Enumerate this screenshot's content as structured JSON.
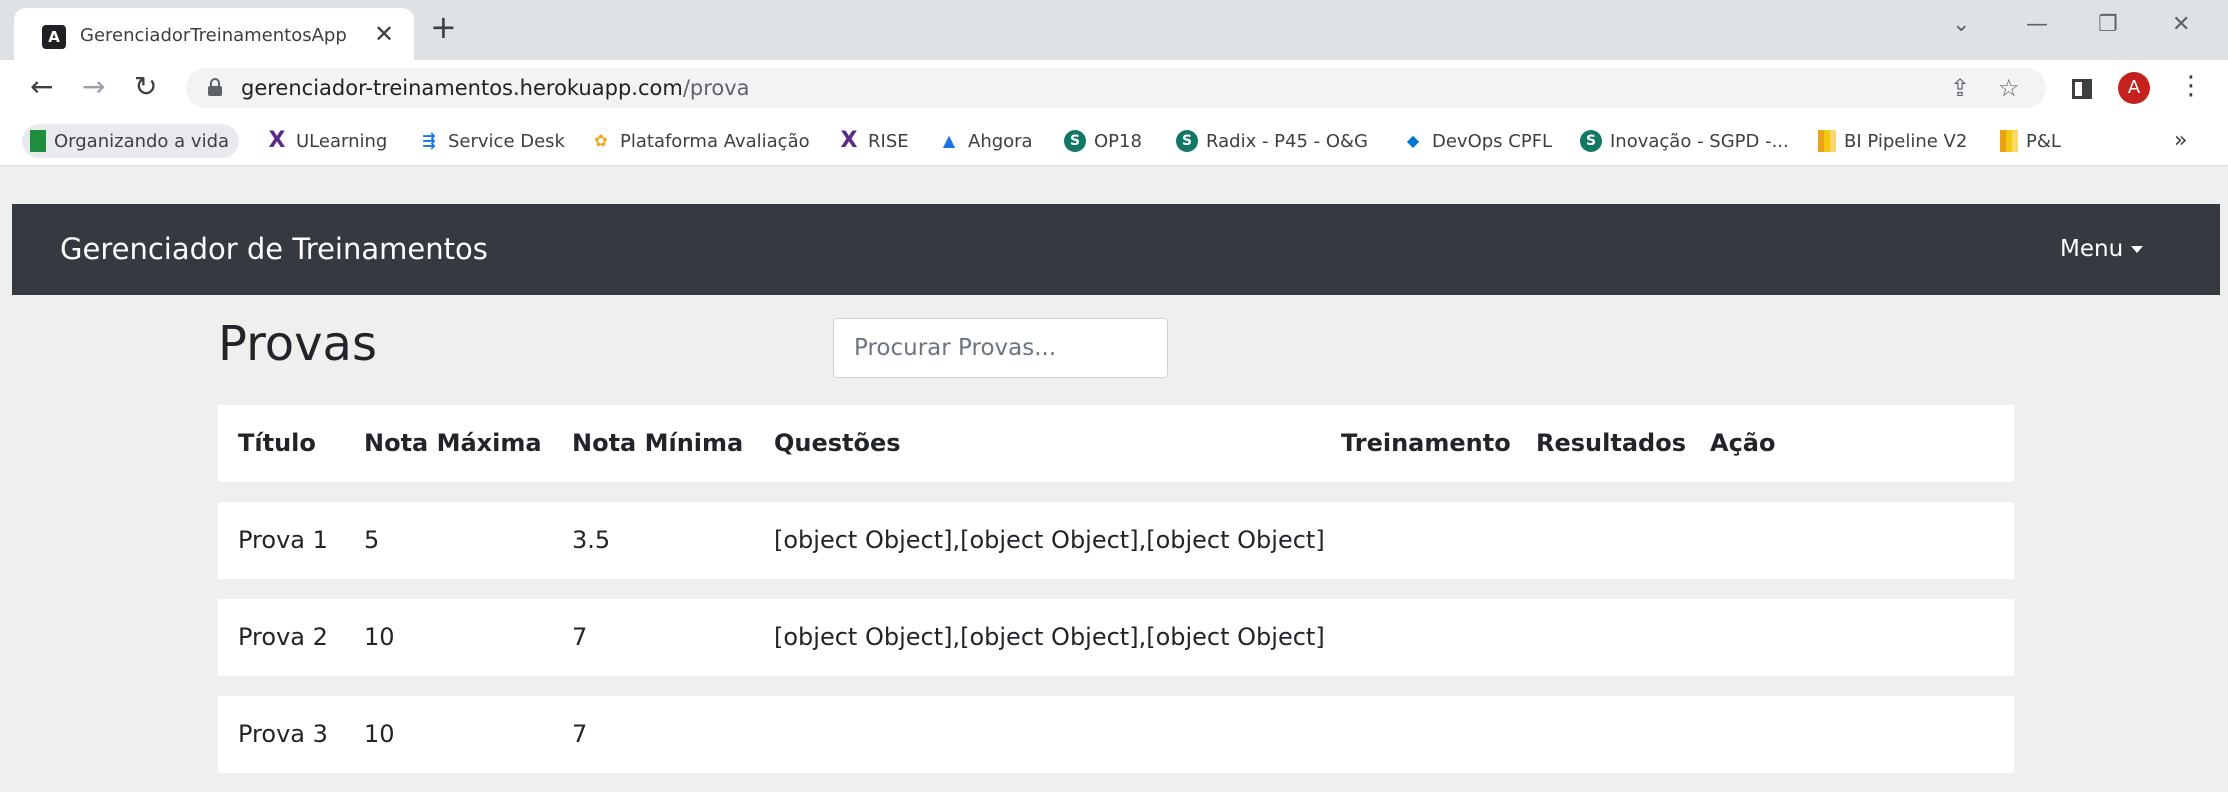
{
  "browser": {
    "tab_title": "GerenciadorTreinamentosApp",
    "tab_favicon_letter": "A",
    "url_host": "gerenciador-treinamentos.herokuapp.com",
    "url_path": "/prova",
    "profile_initial": "A",
    "bookmarks": [
      {
        "label": "Organizando a vida",
        "icon": "green-flag-icon"
      },
      {
        "label": "ULearning",
        "icon": "x-logo-icon"
      },
      {
        "label": "Service Desk",
        "icon": "service-desk-icon"
      },
      {
        "label": "Plataforma Avaliação",
        "icon": "plataforma-icon"
      },
      {
        "label": "RISE",
        "icon": "x-logo-icon"
      },
      {
        "label": "Ahgora",
        "icon": "ahgora-icon"
      },
      {
        "label": "OP18",
        "icon": "sharepoint-icon"
      },
      {
        "label": "Radix - P45 - O&G",
        "icon": "sharepoint-icon"
      },
      {
        "label": "DevOps CPFL",
        "icon": "devops-icon"
      },
      {
        "label": "Inovação - SGPD -...",
        "icon": "sharepoint-icon"
      },
      {
        "label": "BI Pipeline V2",
        "icon": "powerbi-icon"
      },
      {
        "label": "P&L",
        "icon": "powerbi-icon"
      }
    ]
  },
  "navbar": {
    "brand": "Gerenciador de Treinamentos",
    "menu_label": "Menu"
  },
  "page": {
    "title": "Provas",
    "search_placeholder": "Procurar Provas..."
  },
  "table": {
    "headers": [
      "Título",
      "Nota Máxima",
      "Nota Mínima",
      "Questões",
      "Treinamento",
      "Resultados",
      "Ação"
    ],
    "rows": [
      [
        "Prova 1",
        "5",
        "3.5",
        "[object Object],[object Object],[object Object]",
        "",
        "",
        ""
      ],
      [
        "Prova 2",
        "10",
        "7",
        "[object Object],[object Object],[object Object]",
        "",
        "",
        ""
      ],
      [
        "Prova 3",
        "10",
        "7",
        "",
        "",
        "",
        ""
      ]
    ]
  }
}
